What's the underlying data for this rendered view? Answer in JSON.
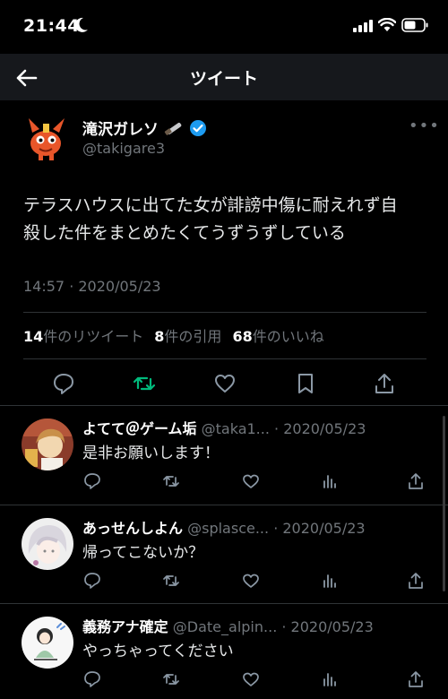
{
  "status": {
    "time": "21:44"
  },
  "nav": {
    "title": "ツイート"
  },
  "tweet": {
    "name": "滝沢ガレソ",
    "handle": "@takigare3",
    "text_line1": "テラスハウスに出てた女が誹謗中傷に耐えれず自",
    "text_line2": "殺した件をまとめたくてうずうずしている",
    "timestamp": "14:57 · 2020/05/23",
    "retweets_count": "14",
    "retweets_label": "件のリツイート",
    "quotes_count": "8",
    "quotes_label": "件の引用",
    "likes_count": "68",
    "likes_label": "件のいいね",
    "verified_color": "#1d9bf0",
    "retweet_color": "#00ba7c"
  },
  "replies": [
    {
      "name": "よてて＠ゲーム垢",
      "handle": "@taka1...",
      "date": "· 2020/05/23",
      "text": "是非お願いします！"
    },
    {
      "name": "あっせんしよん",
      "handle": "@splasce...",
      "date": "· 2020/05/23",
      "text": "帰ってこないか？"
    },
    {
      "name": "義務アナ確定",
      "handle": "@Date_alpin...",
      "date": "· 2020/05/23",
      "text": "やっちゃってください"
    }
  ],
  "icons": {
    "back": "arrow-left-icon",
    "reply": "comment-icon",
    "retweet": "retweet-icon",
    "like": "heart-icon",
    "bookmark": "bookmark-icon",
    "share": "share-icon",
    "analytics": "bar-chart-icon"
  }
}
